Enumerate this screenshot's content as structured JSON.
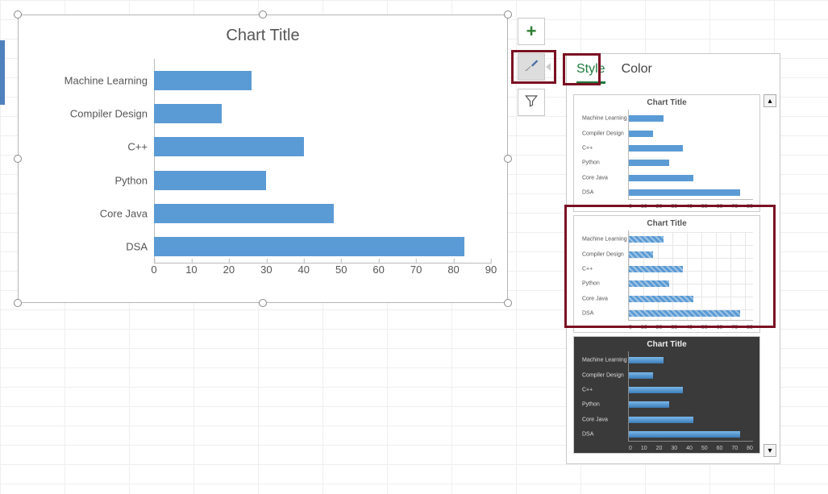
{
  "chart": {
    "title": "Chart Title"
  },
  "chart_data": {
    "type": "bar",
    "orientation": "horizontal",
    "title": "Chart Title",
    "categories": [
      "Machine Learning",
      "Compiler Design",
      "C++",
      "Python",
      "Core Java",
      "DSA"
    ],
    "values": [
      26,
      18,
      40,
      30,
      48,
      83
    ],
    "xlabel": "",
    "ylabel": "",
    "xlim": [
      0,
      90
    ],
    "x_ticks": [
      0,
      10,
      20,
      30,
      40,
      50,
      60,
      70,
      80,
      90
    ]
  },
  "float_buttons": {
    "add": {
      "name": "plus-icon"
    },
    "styles": {
      "name": "paintbrush-icon",
      "active": true
    },
    "filter": {
      "name": "funnel-icon"
    }
  },
  "style_pane": {
    "tabs": {
      "style": "Style",
      "color": "Color",
      "active": "style"
    },
    "previews": [
      {
        "theme": "light",
        "title": "Chart Title"
      },
      {
        "theme": "hatch",
        "title": "Chart Title",
        "selected": true
      },
      {
        "theme": "dark",
        "title": "Chart Title"
      }
    ],
    "preview_x_ticks": [
      0,
      10,
      20,
      30,
      40,
      50,
      60,
      70,
      80
    ]
  }
}
